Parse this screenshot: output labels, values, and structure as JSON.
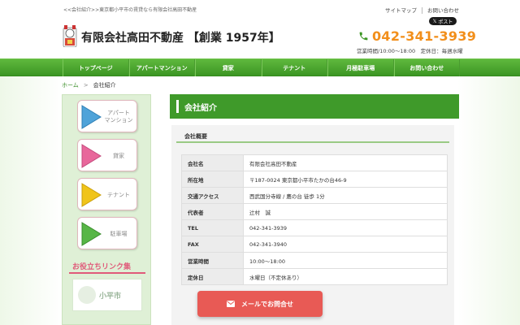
{
  "header": {
    "tagline": "<<会社紹介>>東京都小平市の賃貸なら有限会社高田不動産",
    "title": "有限会社高田不動産 【創業 1957年】",
    "top_links": [
      "サイトマップ",
      "お問い合わせ"
    ],
    "x_post": "ポスト",
    "phone": "042-341-3939",
    "hours": "営業時間/10:00～18:00　定休日：毎週水曜"
  },
  "nav": {
    "items": [
      "トップページ",
      "アパートマンション",
      "貸家",
      "テナント",
      "月極駐車場",
      "お問い合わせ"
    ]
  },
  "breadcrumb": {
    "home": "ホーム",
    "separator": ">",
    "current": "会社紹介"
  },
  "sidebar": {
    "buttons": [
      {
        "label": "アパート\nマンション",
        "color": "#4fa3d9"
      },
      {
        "label": "貸家",
        "color": "#e8679b"
      },
      {
        "label": "テナント",
        "color": "#f0c419"
      },
      {
        "label": "駐車場",
        "color": "#57b646"
      }
    ],
    "links_title": "お役立ちリンク集",
    "banner_text": "小平市"
  },
  "main": {
    "title": "会社紹介",
    "section_title": "会社概要",
    "rows": [
      {
        "key": "会社名",
        "value": "有限会社高田不動産"
      },
      {
        "key": "所在地",
        "value": "〒187-0024 東京都小平市たかの台46-9"
      },
      {
        "key": "交通アクセス",
        "value": "西武国分寺線 / 鷹の台 徒歩 1分"
      },
      {
        "key": "代表者",
        "value": "辻村　誠"
      },
      {
        "key": "TEL",
        "value": "042-341-3939"
      },
      {
        "key": "FAX",
        "value": "042-341-3940"
      },
      {
        "key": "営業時間",
        "value": "10:00～18:00"
      },
      {
        "key": "定休日",
        "value": "水曜日（不定休あり）"
      }
    ]
  },
  "contact_button": {
    "label": "メールでお問合せ"
  },
  "colors": {
    "brand_green": "#3f9a2a",
    "phone_orange": "#f28f1b",
    "accent_pink": "#e05a7a",
    "contact_red": "#e85a55"
  }
}
